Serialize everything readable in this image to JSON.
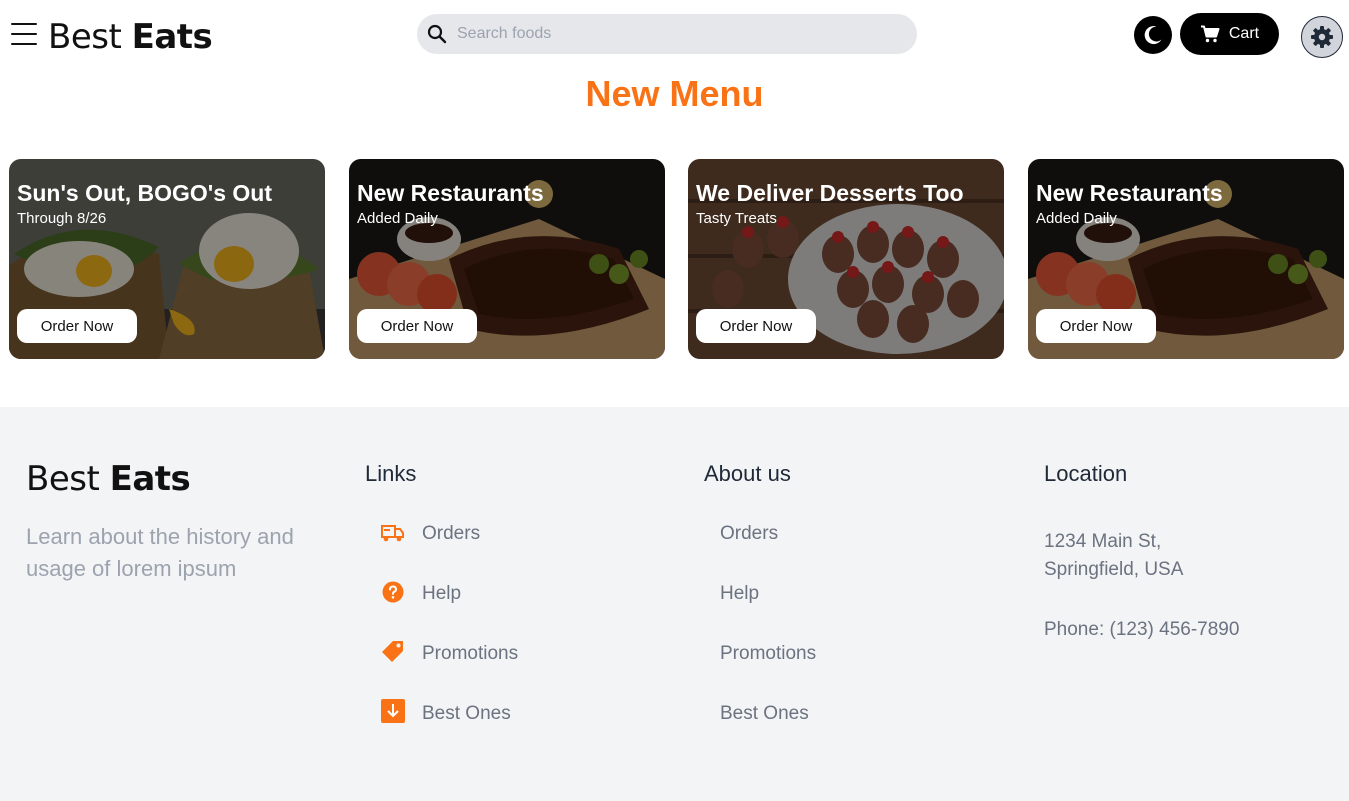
{
  "header": {
    "logo_part1": "Best",
    "logo_part2": "Eats",
    "search_placeholder": "Search foods",
    "cart_label": "Cart"
  },
  "main": {
    "title": "New Menu",
    "cards": [
      {
        "title": "Sun's Out, BOGO's Out",
        "subtitle": "Through 8/26",
        "button": "Order Now",
        "image": "eggs-toast"
      },
      {
        "title": "New Restaurants",
        "subtitle": "Added Daily",
        "button": "Order Now",
        "image": "ribs-board"
      },
      {
        "title": "We Deliver Desserts Too",
        "subtitle": "Tasty Treats",
        "button": "Order Now",
        "image": "chocolate-strawberries"
      },
      {
        "title": "New Restaurants",
        "subtitle": "Added Daily",
        "button": "Order Now",
        "image": "ribs-board"
      }
    ]
  },
  "footer": {
    "logo_part1": "Best",
    "logo_part2": "Eats",
    "description": "Learn about the history and usage of lorem ipsum",
    "links": {
      "title": "Links",
      "items": [
        {
          "label": "Orders",
          "icon": "truck-icon"
        },
        {
          "label": "Help",
          "icon": "question-circle-icon"
        },
        {
          "label": "Promotions",
          "icon": "tag-icon"
        },
        {
          "label": "Best Ones",
          "icon": "download-box-icon"
        }
      ]
    },
    "about": {
      "title": "About us",
      "items": [
        "Orders",
        "Help",
        "Promotions",
        "Best Ones"
      ]
    },
    "location": {
      "title": "Location",
      "address_line1": "1234 Main St,",
      "address_line2": "Springfield, USA",
      "phone": "Phone: (123) 456-7890"
    }
  },
  "colors": {
    "accent": "#f97316",
    "footer_bg": "#f3f4f6",
    "search_bg": "#e5e7eb"
  }
}
